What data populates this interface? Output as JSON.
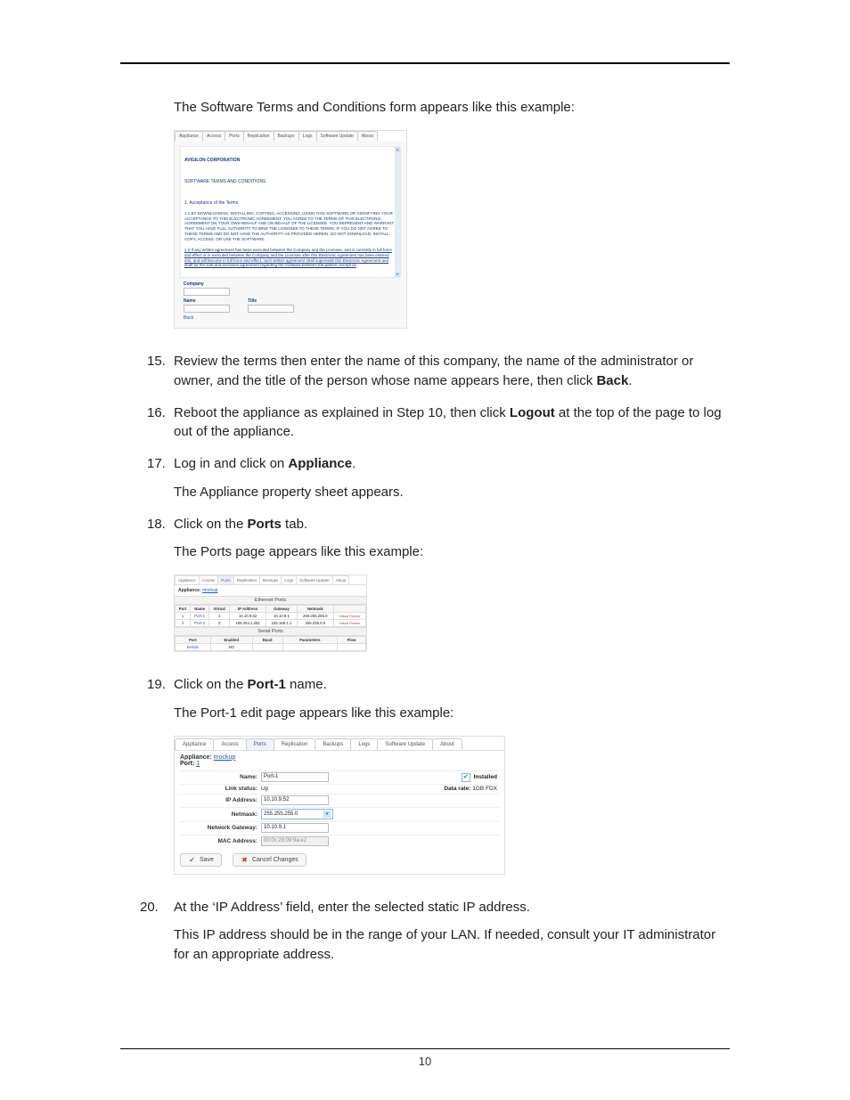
{
  "intro1": "The Software Terms and Conditions form appears like this example:",
  "fig1": {
    "tabs": [
      "Appliance",
      "Access",
      "Ports",
      "Replication",
      "Backups",
      "Logs",
      "Software Update",
      "About"
    ],
    "company": "AVIGILON CORPORATION",
    "doc_title": "SOFTWARE TERMS AND CONDITIONS",
    "section1": "1. Acceptance of the Terms",
    "para11": "1.1 BY DOWNLOADING, INSTALLING, COPYING, ACCESSING, USING THIS SOFTWARE OR SIGNIFYING YOUR ACCEPTANCE TO THIS ELECTRONIC AGREEMENT, YOU AGREE TO THE TERMS OF THIS ELECTRONIC AGREEMENT ON YOUR OWN BEHALF AND ON BEHALF OF THE LICENSEE. YOU REPRESENT AND WARRANT THAT YOU HAVE FULL AUTHORITY TO BIND THE LICENSEE TO THESE TERMS. IF YOU DO NOT AGREE TO THESE TERMS AND DO NOT HAVE THE AUTHORITY AS PROVIDED HEREIN, DO NOT DOWNLOAD, INSTALL, COPY, ACCESS, OR USE THE SOFTWARE.",
    "para12": "1.2 If any written agreement has been executed between the Company and the Licensee, and is currently in full force and effect or is executed between the Company and the Licensee after this Electronic Agreement has been entered into, and will become in full force and effect, such written agreement shall supersede this Electronic Agreement and shall be the sole and exclusive agreement regarding the Software between the parties, except as",
    "labels": {
      "company": "Company",
      "name": "Name",
      "title": "Title",
      "back": "Back"
    }
  },
  "step15": {
    "txt_a": "Review the terms then enter the name of this company, the name of the administrator or owner, and the title of the person whose name appears here, then click ",
    "back": "Back",
    "txt_b": "."
  },
  "step16": {
    "txt_a": "Reboot the appliance as explained in Step 10, then click ",
    "logout": "Logout",
    "txt_b": " at the top of the page to log out of the appliance."
  },
  "step17": {
    "txt_a": "Log in and click on ",
    "appliance": "Appliance",
    "txt_b": ".",
    "line2": "The Appliance property sheet appears."
  },
  "step18": {
    "txt_a": "Click on the ",
    "ports": "Ports",
    "txt_b": " tab.",
    "line2": "The Ports page appears like this example:"
  },
  "fig2": {
    "tabs": [
      "Appliance",
      "Access",
      "Ports",
      "Replication",
      "Backups",
      "Logs",
      "Software Update",
      "About"
    ],
    "appliance_label": "Appliance:",
    "appliance_val": "mockup",
    "title_e": "Ethernet Ports",
    "eth_headers": [
      "Port",
      "Name",
      "Virtual",
      "IP Address",
      "Gateway",
      "Netmask",
      ""
    ],
    "eth_rows": [
      {
        "port": "1",
        "name": "Port-1",
        "virtual": "1",
        "ip": "10.10.9.52",
        "gw": "10.10.9.1",
        "mask": "255.255.255.0",
        "action": "Virtual Routes"
      },
      {
        "port": "2",
        "name": "Port-2",
        "virtual": "0",
        "ip": "169.254.1.251",
        "gw": "192.168.1.1",
        "mask": "255.255.0.0",
        "action": "Virtual Routes"
      }
    ],
    "title_s": "Serial Ports",
    "ser_headers": [
      "Port",
      "Enabled",
      "Baud",
      "Parameters",
      "Flow"
    ],
    "ser_row": {
      "port": "Serial1",
      "enabled": "NO"
    }
  },
  "step19": {
    "txt_a": "Click on the ",
    "port1": "Port-1",
    "txt_b": " name.",
    "line2": "The Port-1 edit page appears like this example:"
  },
  "fig3": {
    "tabs": [
      "Appliance",
      "Access",
      "Ports",
      "Replication",
      "Backups",
      "Logs",
      "Software Update",
      "About"
    ],
    "appliance_label": "Appliance:",
    "appliance_val": "mockup",
    "port_label": "Port:",
    "port_val": "1",
    "rows": {
      "name_l": "Name:",
      "name_v": "Port-1",
      "installed_l": "Installed",
      "link_l": "Link status:",
      "link_v": "Up",
      "rate_l": "Data rate:",
      "rate_v": "1GB FDX",
      "ip_l": "IP Address:",
      "ip_v": "10.10.9.52",
      "mask_l": "Netmask:",
      "mask_v": "255.255.255.0",
      "gw_l": "Network Gateway:",
      "gw_v": "10.10.9.1",
      "mac_l": "MAC Address:",
      "mac_v": "00:0c:29:09:9a:e2"
    },
    "btn_save": "Save",
    "btn_cancel": "Cancel Changes"
  },
  "step20": {
    "txt_a": "At the ‘IP Address’ field, enter the selected static IP address.",
    "line2": "This IP address should be in the range of your LAN. If needed, consult your IT administrator for an appropriate address."
  },
  "page_number": "10"
}
